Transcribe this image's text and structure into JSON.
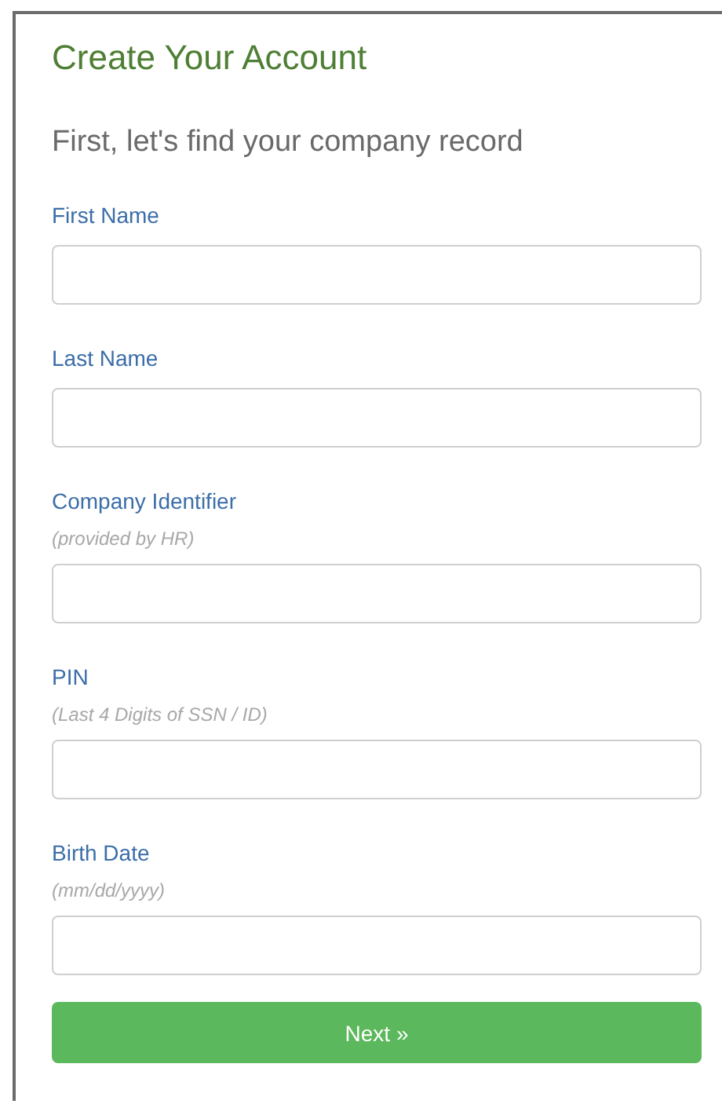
{
  "title": "Create Your Account",
  "subtitle": "First, let's find your company record",
  "fields": [
    {
      "label": "First Name"
    },
    {
      "label": "Last Name"
    },
    {
      "label": "Company Identifier",
      "hint": "(provided by HR)"
    },
    {
      "label": "PIN",
      "hint": "(Last 4 Digits of SSN / ID)"
    },
    {
      "label": "Birth Date",
      "hint": "(mm/dd/yyyy)"
    }
  ],
  "button": "Next »"
}
